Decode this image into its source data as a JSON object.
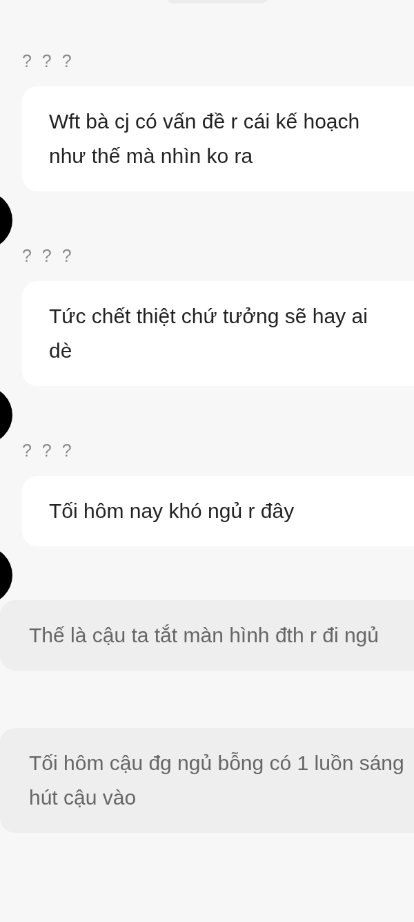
{
  "messages": [
    {
      "kind": "chat",
      "sender": "? ? ?",
      "text": "Wft bà cj có vấn đề r cái kế hoạch như thế mà nhìn ko ra"
    },
    {
      "kind": "chat",
      "sender": "? ? ?",
      "text": "Tức chết thiệt chứ tưởng sẽ hay ai dè"
    },
    {
      "kind": "chat",
      "sender": "? ? ?",
      "text": "Tối hôm nay khó ngủ r đây"
    },
    {
      "kind": "narration",
      "text": "Thế là cậu ta tắt màn hình đth r đi ngủ"
    },
    {
      "kind": "narration",
      "text": "Tối hôm cậu đg ngủ bỗng có 1 luồn sáng hút cậu vào"
    }
  ]
}
